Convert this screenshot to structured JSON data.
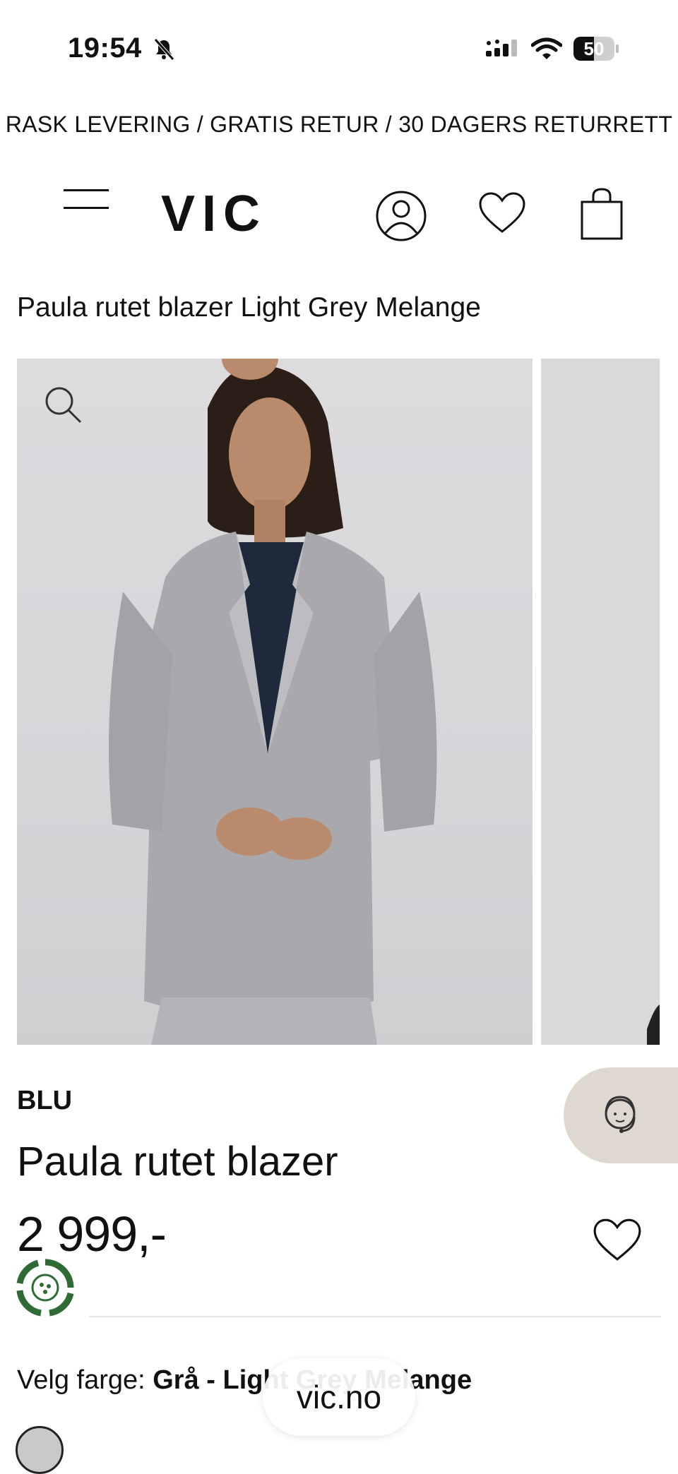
{
  "status_bar": {
    "time": "19:54",
    "battery_level": 50,
    "battery_label": "50"
  },
  "promo_banner": "RASK LEVERING / GRATIS RETUR / 30 DAGERS RETURRETT",
  "header": {
    "logo": "VIC"
  },
  "page_title": "Paula rutet blazer Light Grey Melange",
  "product": {
    "brand": "BLU",
    "name": "Paula rutet blazer",
    "price": "2 999,-",
    "color_label": "Velg farge: ",
    "color_value": "Grå - Light Grey Melange"
  },
  "browser": {
    "url": "vic.no"
  }
}
